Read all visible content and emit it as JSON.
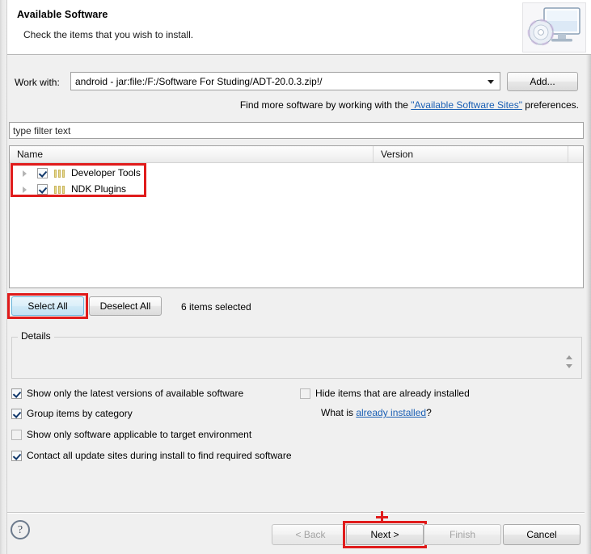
{
  "window": {
    "title": "Available Software",
    "subtitle": "Check the items that you wish to install.",
    "banner_icon": "monitor-with-disc-icon"
  },
  "work_with": {
    "label": "Work with:",
    "value": "android - jar:file:/F:/Software For Studing/ADT-20.0.3.zip!/",
    "dropdown_icon": "chevron-down-icon",
    "add_button": "Add..."
  },
  "find_more": {
    "prefix": "Find more software by working with the ",
    "link": "\"Available Software Sites\"",
    "suffix": " preferences."
  },
  "filter": {
    "placeholder": "type filter text",
    "value": "type filter text"
  },
  "tree": {
    "columns": [
      "Name",
      "Version"
    ],
    "rows": [
      {
        "label": "Developer Tools",
        "version": "",
        "checked": true,
        "expandable": true,
        "icon": "category-icon"
      },
      {
        "label": "NDK Plugins",
        "version": "",
        "checked": true,
        "expandable": true,
        "icon": "category-icon"
      }
    ]
  },
  "selection_bar": {
    "select_all": "Select All",
    "deselect_all": "Deselect All",
    "status": "6 items selected"
  },
  "details": {
    "legend": "Details",
    "content": "",
    "spinner_icon": "spinner-up-down-icon"
  },
  "options": {
    "left": [
      {
        "label": "Show only the latest versions of available software",
        "checked": true
      },
      {
        "label": "Group items by category",
        "checked": true
      },
      {
        "label": "Show only software applicable to target environment",
        "checked": false
      },
      {
        "label": "Contact all update sites during install to find required software",
        "checked": true
      }
    ],
    "right": [
      {
        "label": "Hide items that are already installed",
        "checked": false
      }
    ],
    "what_is": {
      "prefix": "What is ",
      "link": "already installed",
      "suffix": "?"
    }
  },
  "footer": {
    "help_icon": "question-mark-icon",
    "back": "< Back",
    "next": "Next >",
    "finish": "Finish",
    "cancel": "Cancel"
  },
  "annotations": {
    "colors": {
      "highlight": "#e01b1b",
      "link": "#1a5fb4",
      "focus": "#6bb7dd"
    },
    "cursor_icon": "crosshair-plus-cursor"
  }
}
